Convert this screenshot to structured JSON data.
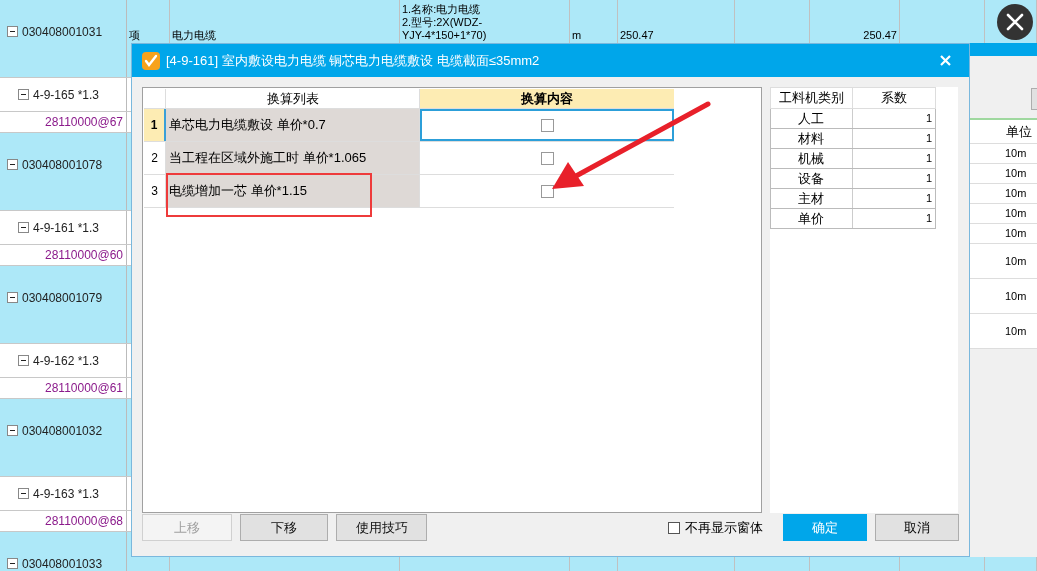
{
  "sheet": {
    "rows": [
      {
        "code": "030408001031",
        "expanded": true,
        "cells": [
          "项",
          "电力电缆",
          "1.名称:电力电缆\n2.型号:2X(WDZ-\nYJY-4*150+1*70)",
          "m",
          "250.47",
          "",
          "250.47"
        ],
        "children": [
          {
            "code": "4-9-165 *1.3",
            "expanded": true,
            "children": [
              {
                "code": "28110000@67"
              }
            ]
          }
        ]
      },
      {
        "code": "030408001078",
        "expanded": true,
        "children": [
          {
            "code": "4-9-161 *1.3",
            "expanded": true,
            "children": [
              {
                "code": "28110000@60"
              }
            ]
          }
        ]
      },
      {
        "code": "030408001079",
        "expanded": true,
        "children": [
          {
            "code": "4-9-162 *1.3",
            "expanded": true,
            "children": [
              {
                "code": "28110000@61"
              }
            ]
          }
        ]
      },
      {
        "code": "030408001032",
        "expanded": true,
        "children": [
          {
            "code": "4-9-163 *1.3",
            "expanded": true,
            "children": [
              {
                "code": "28110000@68"
              }
            ]
          }
        ]
      },
      {
        "code": "030408001033",
        "expanded": true,
        "children": []
      }
    ]
  },
  "unit_column": {
    "header": "单位",
    "cells": [
      "10m",
      "10m",
      "10m",
      "10m",
      "10m",
      "10m",
      "10m",
      "10m"
    ]
  },
  "dialog": {
    "title": "[4-9-161] 室内敷设电力电缆 铜芯电力电缆敷设 电缆截面≤35mm2",
    "columns": [
      "换算列表",
      "换算内容"
    ],
    "rows": [
      {
        "number": "1",
        "text": "单芯电力电缆敷设 单价*0.7",
        "checked": false,
        "selected": true
      },
      {
        "number": "2",
        "text": "当工程在区域外施工时 单价*1.065",
        "checked": false,
        "selected": false
      },
      {
        "number": "3",
        "text": "电缆增加一芯 单价*1.15",
        "checked": false,
        "selected": false,
        "highlighted": true
      }
    ],
    "factor_table": {
      "columns": [
        "工料机类别",
        "系数"
      ],
      "rows": [
        [
          "人工",
          "1"
        ],
        [
          "材料",
          "1"
        ],
        [
          "机械",
          "1"
        ],
        [
          "设备",
          "1"
        ],
        [
          "主材",
          "1"
        ],
        [
          "单价",
          "1"
        ]
      ]
    },
    "buttons": [
      {
        "label": "上移",
        "disabled": true
      },
      {
        "label": "下移",
        "disabled": false
      },
      {
        "label": "使用技巧",
        "disabled": false
      }
    ],
    "dont_show": {
      "label": "不再显示窗体",
      "checked": false
    },
    "ok": "确定",
    "cancel": "取消"
  }
}
